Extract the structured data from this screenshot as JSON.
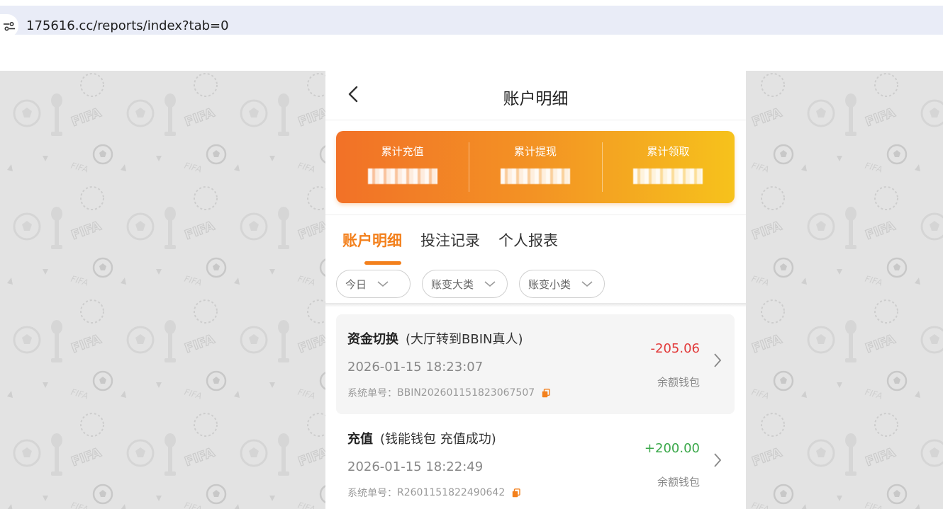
{
  "browser": {
    "url": "175616.cc/reports/index?tab=0",
    "site_info_icon": "tune-icon"
  },
  "header": {
    "back_icon": "chevron-left-icon",
    "title": "账户明细"
  },
  "summary": {
    "items": [
      {
        "label": "累计充值",
        "value": ""
      },
      {
        "label": "累计提现",
        "value": ""
      },
      {
        "label": "累计领取",
        "value": ""
      }
    ],
    "colors": {
      "from": "#f27127",
      "to": "#f6c21c"
    }
  },
  "tabs": [
    {
      "label": "账户明细",
      "active": true
    },
    {
      "label": "投注记录",
      "active": false
    },
    {
      "label": "个人报表",
      "active": false
    }
  ],
  "filters": [
    {
      "label": "今日"
    },
    {
      "label": "账变大类"
    },
    {
      "label": "账变小类"
    }
  ],
  "records": [
    {
      "type": "资金切换",
      "desc": "(大厅转到BBIN真人)",
      "time": "2026-01-15 18:23:07",
      "order_label": "系统单号：",
      "order_no": "BBIN202601151823067507",
      "amount": "-205.06",
      "wallet": "余额钱包"
    },
    {
      "type": "充值",
      "desc": "(钱能钱包 充值成功)",
      "time": "2026-01-15 18:22:49",
      "order_label": "系统单号：",
      "order_no": "R2601151822490642",
      "amount": "+200.00",
      "wallet": "余额钱包"
    }
  ],
  "colors": {
    "accent": "#f3801c",
    "negative": "#e23a3a",
    "positive": "#3aa84a",
    "background_pattern": "#e3e3e3"
  }
}
